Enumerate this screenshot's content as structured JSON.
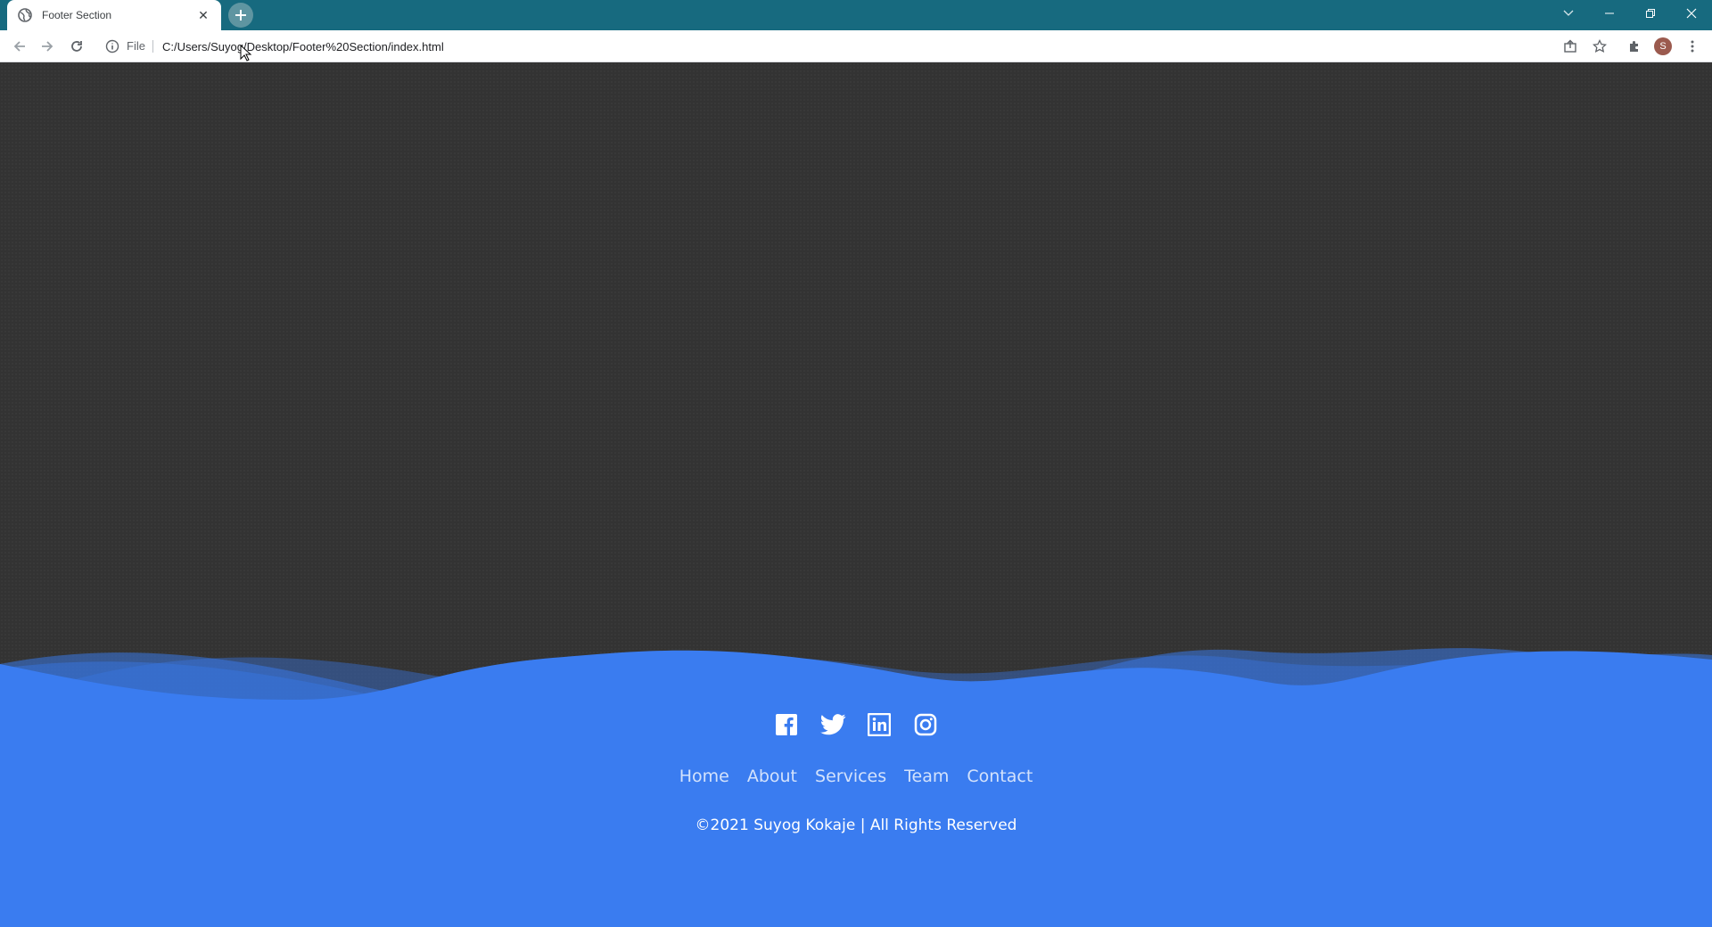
{
  "browser": {
    "tab_title": "Footer Section",
    "scheme_label": "File",
    "url": "C:/Users/Suyog/Desktop/Footer%20Section/index.html",
    "profile_initial": "S"
  },
  "page": {
    "social_icons": [
      "facebook-icon",
      "twitter-icon",
      "linkedin-icon",
      "instagram-icon"
    ],
    "menu": [
      "Home",
      "About",
      "Services",
      "Team",
      "Contact"
    ],
    "copyright": "©2021 Suyog Kokaje | All Rights Reserved"
  },
  "colors": {
    "titlebar": "#176a7f",
    "page_background": "#333333",
    "footer": "#3a7cf0",
    "text_white": "#ffffff"
  }
}
